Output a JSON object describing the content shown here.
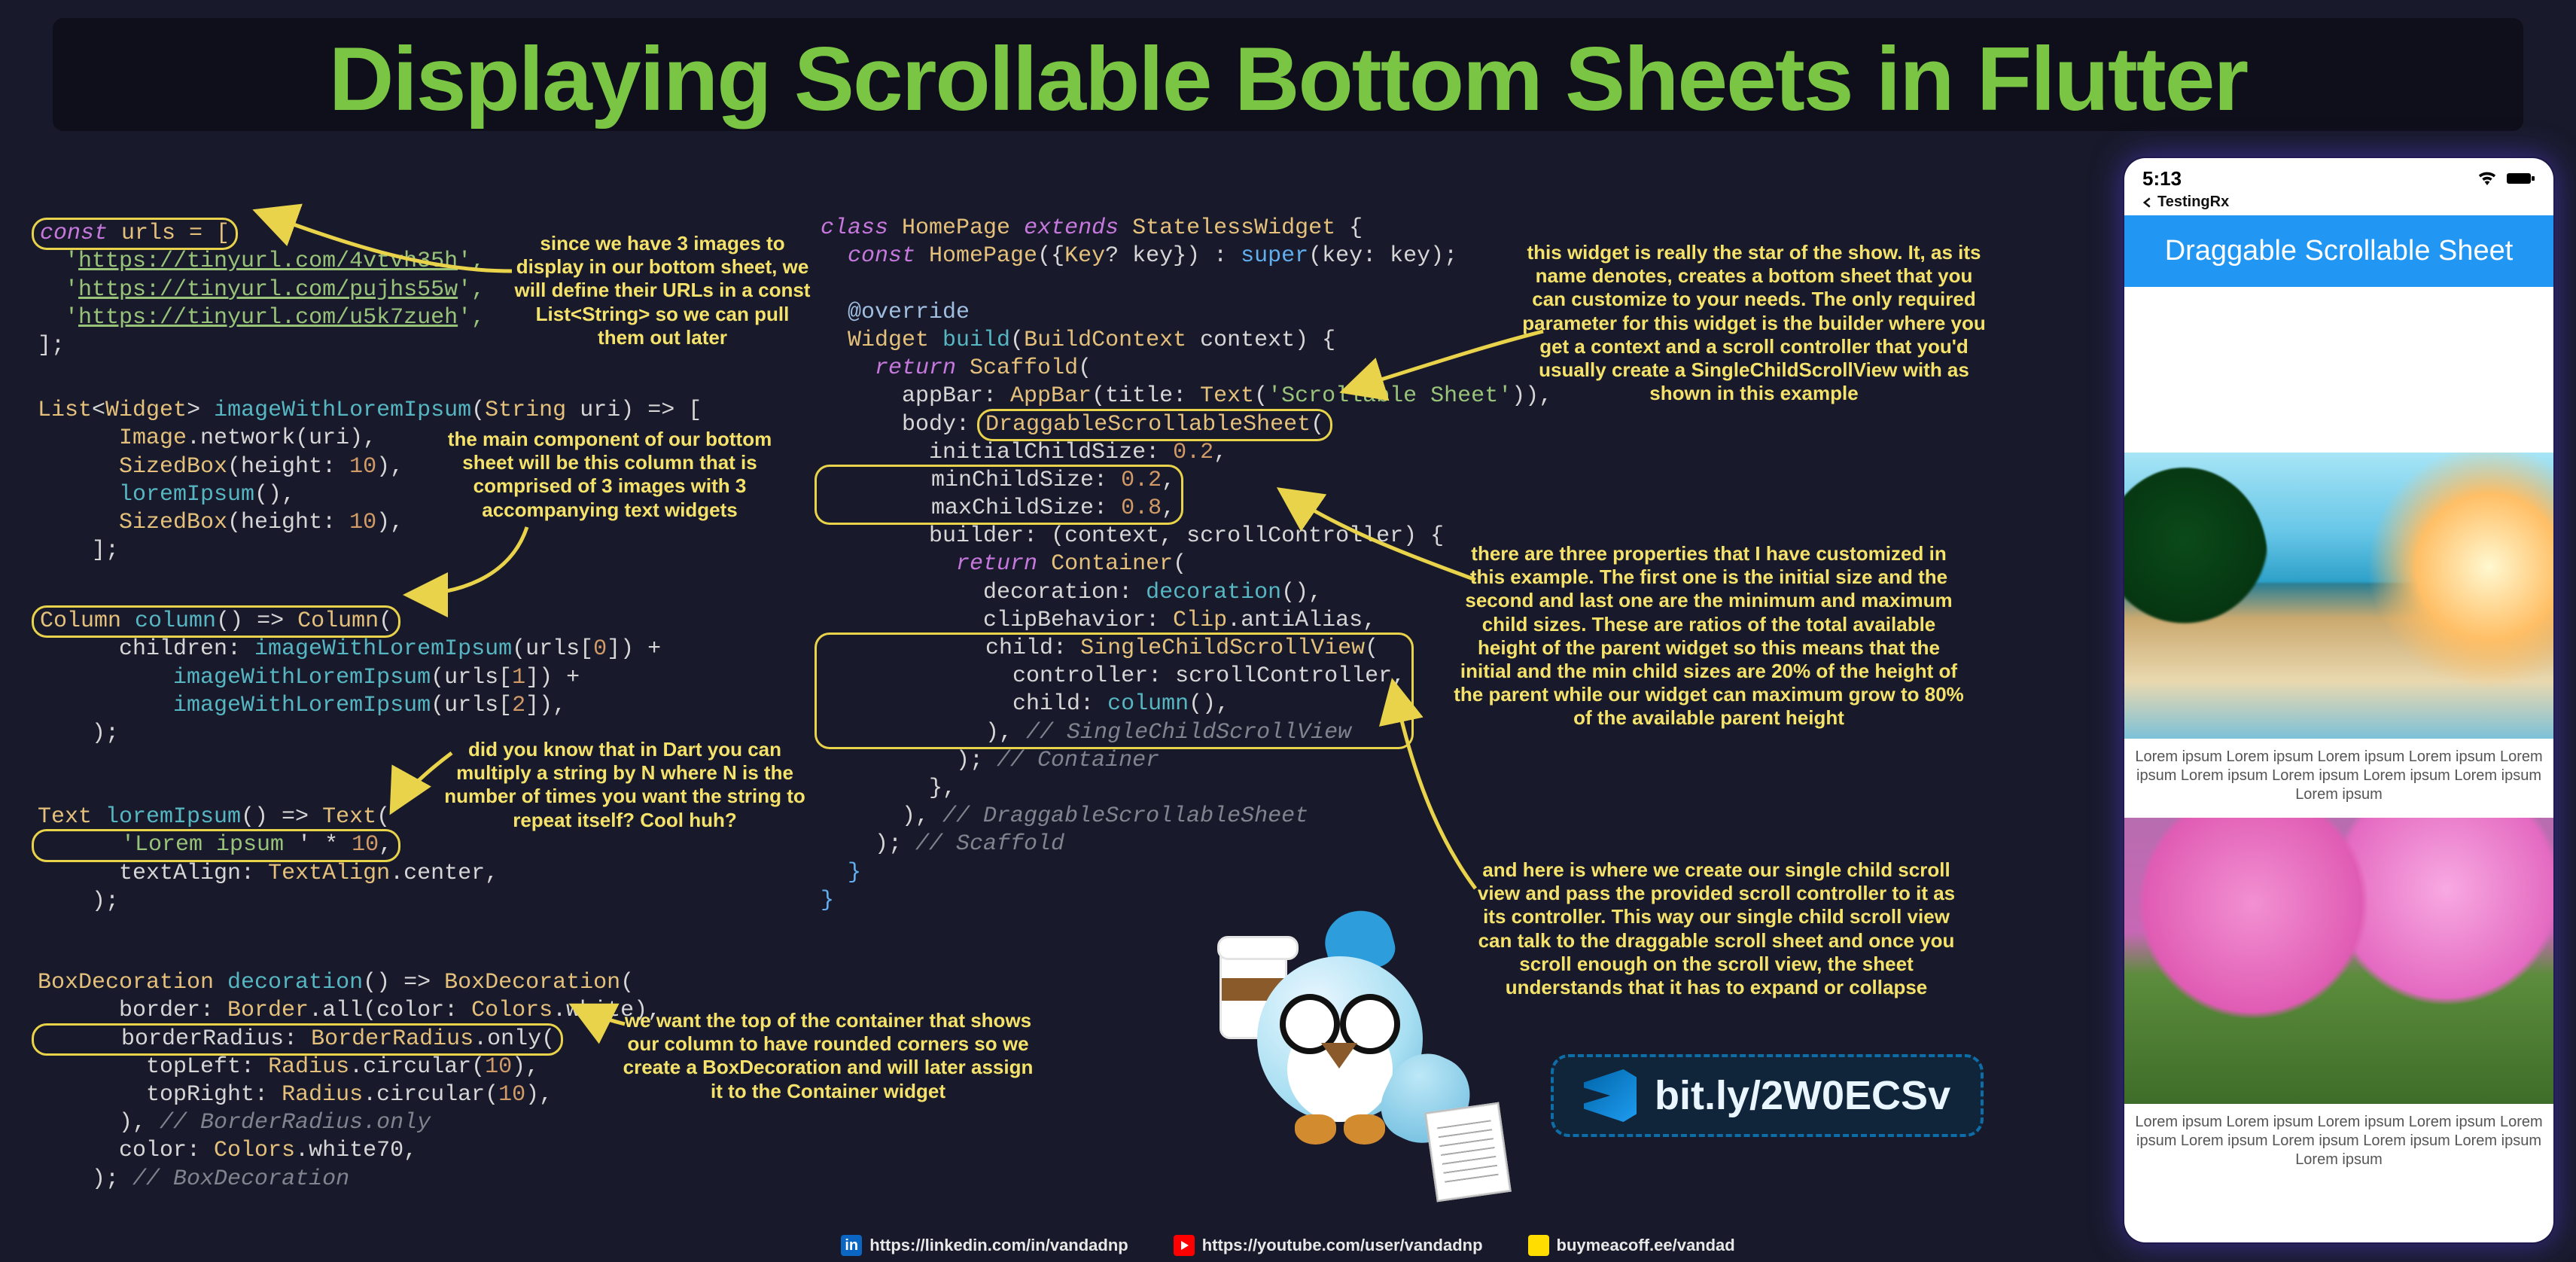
{
  "title": "Displaying Scrollable Bottom Sheets in Flutter",
  "code_left": {
    "block1": {
      "l1a": "const",
      "l1b": " urls = [",
      "l2a": "  '",
      "l2b": "https://tinyurl.com/4vtvh35h",
      "l2c": "',",
      "l3a": "  '",
      "l3b": "https://tinyurl.com/pujhs55w",
      "l3c": "',",
      "l4a": "  '",
      "l4b": "https://tinyurl.com/u5k7zueh",
      "l4c": "',",
      "l5": "];"
    },
    "block2": {
      "l1a": "List",
      "l1b": "<",
      "l1c": "Widget",
      "l1d": "> ",
      "l1e": "imageWithLoremIpsum",
      "l1f": "(",
      "l1g": "String",
      "l1h": " uri) => [",
      "l2a": "      Image",
      "l2b": ".network(uri),",
      "l3a": "      SizedBox",
      "l3b": "(height: ",
      "l3c": "10",
      "l3d": "),",
      "l4a": "      loremIpsum",
      "l4b": "(),",
      "l5a": "      SizedBox",
      "l5b": "(height: ",
      "l5c": "10",
      "l5d": "),",
      "l6": "    ];"
    },
    "block3": {
      "l1a": "Column ",
      "l1b": "column",
      "l1c": "() => ",
      "l1d": "Column",
      "l1e": "(",
      "l2a": "      children: ",
      "l2b": "imageWithLoremIpsum",
      "l2c": "(urls[",
      "l2d": "0",
      "l2e": "]) +",
      "l3a": "          imageWithLoremIpsum",
      "l3b": "(urls[",
      "l3c": "1",
      "l3d": "]) +",
      "l4a": "          imageWithLoremIpsum",
      "l4b": "(urls[",
      "l4c": "2",
      "l4d": "]),",
      "l5": "    );"
    },
    "block4": {
      "l1a": "Text ",
      "l1b": "loremIpsum",
      "l1c": "() => ",
      "l1d": "Text",
      "l1e": "(",
      "l2a": "      '",
      "l2b": "Lorem ipsum ",
      "l2c": "' * ",
      "l2d": "10",
      "l2e": ",",
      "l3a": "      textAlign: ",
      "l3b": "TextAlign",
      "l3c": ".center,",
      "l4": "    );"
    },
    "block5": {
      "l1a": "BoxDecoration ",
      "l1b": "decoration",
      "l1c": "() => ",
      "l1d": "BoxDecoration",
      "l1e": "(",
      "l2a": "      border: ",
      "l2b": "Border",
      "l2c": ".all(color: ",
      "l2d": "Colors",
      "l2e": ".white),",
      "l3a": "      borderRadius: ",
      "l3b": "BorderRadius",
      "l3c": ".only(",
      "l4a": "        topLeft: ",
      "l4b": "Radius",
      "l4c": ".circular(",
      "l4d": "10",
      "l4e": "),",
      "l5a": "        topRight: ",
      "l5b": "Radius",
      "l5c": ".circular(",
      "l5d": "10",
      "l5e": "),",
      "l6a": "      ), ",
      "l6b": "// BorderRadius.only",
      "l7a": "      color: ",
      "l7b": "Colors",
      "l7c": ".white70,",
      "l8a": "    ); ",
      "l8b": "// BoxDecoration"
    }
  },
  "code_right": {
    "l1a": "class ",
    "l1b": "HomePage",
    "l1c": " extends ",
    "l1d": "StatelessWidget",
    "l1e": " {",
    "l2a": "  const ",
    "l2b": "HomePage",
    "l2c": "({",
    "l2d": "Key",
    "l2e": "? key}) : ",
    "l2f": "super",
    "l2g": "(key: key);",
    "l3": "",
    "l4a": "  @override",
    "l5a": "  Widget ",
    "l5b": "build",
    "l5c": "(",
    "l5d": "BuildContext",
    "l5e": " context) {",
    "l6a": "    return ",
    "l6b": "Scaffold",
    "l6c": "(",
    "l7a": "      appBar: ",
    "l7b": "AppBar",
    "l7c": "(title: ",
    "l7d": "Text",
    "l7e": "(",
    "l7f": "'Scrollable Sheet'",
    "l7g": ")),",
    "l8a": "      body: ",
    "l8b": "DraggableScrollableSheet",
    "l8c": "(",
    "l9a": "        initialChildSize: ",
    "l9b": "0.2",
    "l9c": ",",
    "l10a": "        minChildSize: ",
    "l10b": "0.2",
    "l10c": ",",
    "l11a": "        maxChildSize: ",
    "l11b": "0.8",
    "l11c": ",",
    "l12a": "        builder: (context, scrollController) {",
    "l13a": "          return ",
    "l13b": "Container",
    "l13c": "(",
    "l14a": "            decoration: ",
    "l14b": "decoration",
    "l14c": "(),",
    "l15a": "            clipBehavior: ",
    "l15b": "Clip",
    "l15c": ".antiAlias,",
    "l16a": "            child: ",
    "l16b": "SingleChildScrollView",
    "l16c": "(",
    "l17a": "              controller: scrollController,",
    "l18a": "              child: ",
    "l18b": "column",
    "l18c": "(),",
    "l19a": "            ), ",
    "l19b": "// SingleChildScrollView",
    "l20a": "          ); ",
    "l20b": "// Container",
    "l21": "        },",
    "l22a": "      ), ",
    "l22b": "// DraggableScrollableSheet",
    "l23a": "    ); ",
    "l23b": "// Scaffold",
    "l24": "  }",
    "l25": "}"
  },
  "notes": {
    "n_urls": "since we have 3 images to display in our bottom sheet, we will define their URLs in a const List<String> so we can pull them out later",
    "n_column": "the main component of our bottom sheet will be this column that is comprised of 3 images with 3 accompanying text widgets",
    "n_multiply": "did you know that in Dart you can multiply a string by N where N is the number of times you want the string to repeat itself? Cool huh?",
    "n_decoration": "we want the top of the container that shows our column to have rounded corners so we create a BoxDecoration and will later assign it to the Container widget",
    "n_draggable": "this widget is really the star of the show. It, as its name denotes, creates a bottom sheet that you can customize to your needs. The only required parameter for this widget is the builder where you get a context and a scroll controller that you'd usually create a SingleChildScrollView with as shown in this example",
    "n_sizes": "there are three properties that I have customized in this example. The first one is the initial size and the second and last one are the minimum and maximum child sizes. These are ratios of the total available height of the parent widget so this means that the initial and the min child sizes are 20% of the height of the parent while our widget can maximum grow to 80% of the available parent height",
    "n_scroll": "and here is where we create our single child scroll view and pass the provided scroll controller to it as its controller. This way our single child scroll view can talk to the draggable scroll sheet and once you scroll enough on the scroll view, the sheet understands that it has to expand or collapse"
  },
  "link": "bit.ly/2W0ECSv",
  "socials": {
    "li": "https://linkedin.com/in/vandadnp",
    "yt": "https://youtube.com/user/vandadnp",
    "bc": "buymeacoff.ee/vandad"
  },
  "phone": {
    "time": "5:13",
    "device": "TestingRx",
    "app_title": "Draggable Scrollable Sheet",
    "ipsum": "Lorem ipsum Lorem ipsum Lorem ipsum Lorem ipsum Lorem ipsum Lorem ipsum Lorem ipsum Lorem ipsum Lorem ipsum Lorem ipsum"
  }
}
